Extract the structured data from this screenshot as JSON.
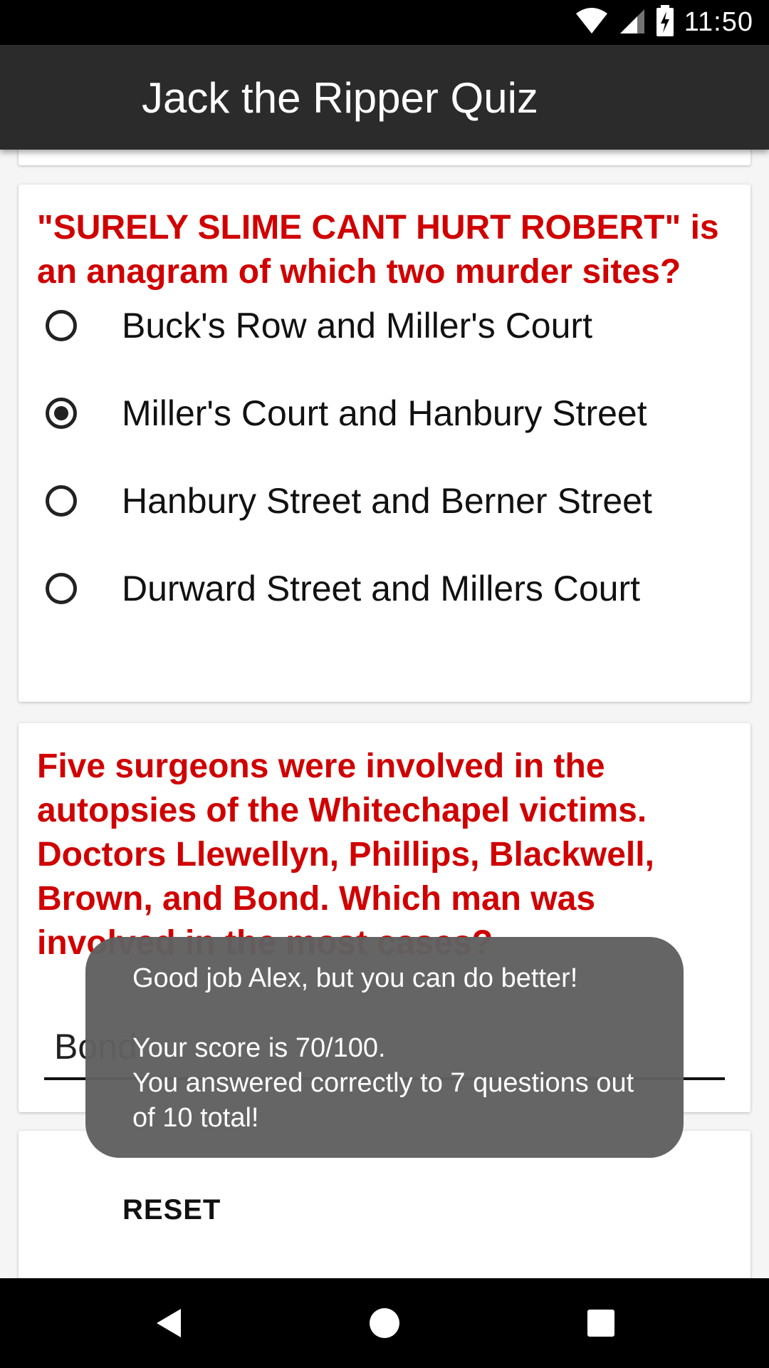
{
  "status_bar": {
    "time": "11:50",
    "icons": [
      "wifi-icon",
      "signal-icon",
      "battery-charging-icon"
    ]
  },
  "app_bar": {
    "title": "Jack the Ripper Quiz"
  },
  "question1": {
    "text": "\"SURELY SLIME CANT HURT ROBERT\" is an anagram of which two murder sites?",
    "options": [
      {
        "label": "Buck's Row and Miller's Court",
        "selected": false
      },
      {
        "label": "Miller's Court and Hanbury Street",
        "selected": true
      },
      {
        "label": "Hanbury Street and Berner Street",
        "selected": false
      },
      {
        "label": "Durward Street and Millers Court",
        "selected": false
      }
    ]
  },
  "question2": {
    "text": "Five surgeons were involved in the autopsies of the Whitechapel victims. Doctors Llewellyn, Phillips, Blackwell, Brown, and Bond. Which man was involved in the most cases?",
    "answer_value": "Bond"
  },
  "reset": {
    "label": "RESET"
  },
  "toast": {
    "line1": "Good job Alex, but you can do better!",
    "line2": "Your score is 70/100.",
    "line3": "You answered correctly to 7 questions out",
    "line4": "of 10 total!"
  },
  "nav_bar": {
    "icons": [
      "back-icon",
      "home-icon",
      "recents-icon"
    ]
  },
  "colors": {
    "question_red": "#d00000",
    "app_bar": "#2b2b2b",
    "toast_bg": "#606060"
  }
}
